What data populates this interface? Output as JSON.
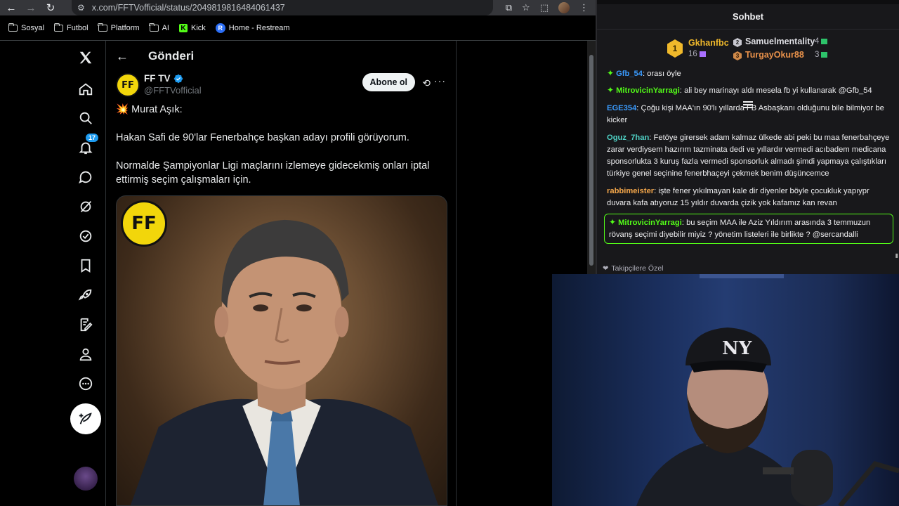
{
  "browser": {
    "url": "x.com/FFTVofficial/status/2049819816484061437",
    "bookmarks": [
      {
        "label": "Sosyal",
        "type": "folder"
      },
      {
        "label": "Futbol",
        "type": "folder"
      },
      {
        "label": "Platform",
        "type": "folder"
      },
      {
        "label": "AI",
        "type": "folder"
      },
      {
        "label": "Kick",
        "type": "kick"
      },
      {
        "label": "Home - Restream",
        "type": "restream"
      }
    ]
  },
  "x": {
    "notification_count": "17",
    "header_title": "Gönderi",
    "author": {
      "name": "FF TV",
      "handle": "@FFTVofficial",
      "avatar_text": "FF"
    },
    "follow_label": "Abone ol",
    "tweet": {
      "line1": "Murat Aşık:",
      "line2": "Hakan Safi de 90'lar Fenerbahçe başkan adayı profili görüyorum.",
      "line3": "Normalde Şampiyonlar Ligi maçlarını izlemeye gidecekmiş onları iptal ettirmiş seçim çalışmaları için."
    },
    "media_logo_text": "FF"
  },
  "chat": {
    "title": "Sohbet",
    "leaderboard": {
      "first": {
        "rank": "1",
        "name": "Gkhanfbc",
        "count": "16"
      },
      "second": {
        "rank": "2",
        "name": "Samuelmentality",
        "count": "4"
      },
      "third": {
        "rank": "3",
        "name": "TurgayOkur88",
        "count": "3"
      }
    },
    "messages": [
      {
        "user": "Gfb_54",
        "text": "orası öyle",
        "color": "#3a9bff",
        "spark": true,
        "cut": true
      },
      {
        "user": "MitrovicinYarragi",
        "text": "ali bey marinayı aldı mesela fb yi kullanarak @Gfb_54",
        "color": "#53fc18",
        "spark": true
      },
      {
        "user": "EGE354",
        "text": "Çoğu kişi MAA'ın 90'lı yıllarda FB Asbaşkanı olduğunu bile bilmiyor be kicker",
        "color": "#3a9bff",
        "spark": false
      },
      {
        "user": "Oguz_7han",
        "text": "Fetöye girersek adam kalmaz ülkede abi peki bu maa fenerbahçeye zarar verdiysem hazırım tazminata dedi ve yıllardır vermedi acıbadem medicana sponsorlukta 3 kuruş fazla vermedi sponsorluk almadı şimdi yapmaya çalıştıkları türkiye genel seçinine fenerbhaçeyi çekmek benim düşüncemce",
        "color": "#4fd1c5",
        "spark": false
      },
      {
        "user": "rabbimeister",
        "text": "işte fener yıkılmayan kale dir diyenler böyle çocukluk yapıypr duvara kafa atıyoruz 15 yıldır duvarda çizik yok kafamız kan revan",
        "color": "#f3a64a",
        "spark": false
      },
      {
        "user": "MitrovicinYarragi",
        "text": "bu seçim MAA ile Aziz Yıldırım arasında 3 temmuzun rövanş seçimi diyebilir miyiz ? yönetim listeleri ile birlikte ? @sercandalli",
        "color": "#53fc18",
        "spark": true,
        "highlight": true
      }
    ],
    "footer_label": "Takipçilere Özel"
  },
  "colors": {
    "x_blue": "#1d9bf0",
    "kick_green": "#53fc18",
    "gold": "#f0b92b"
  }
}
